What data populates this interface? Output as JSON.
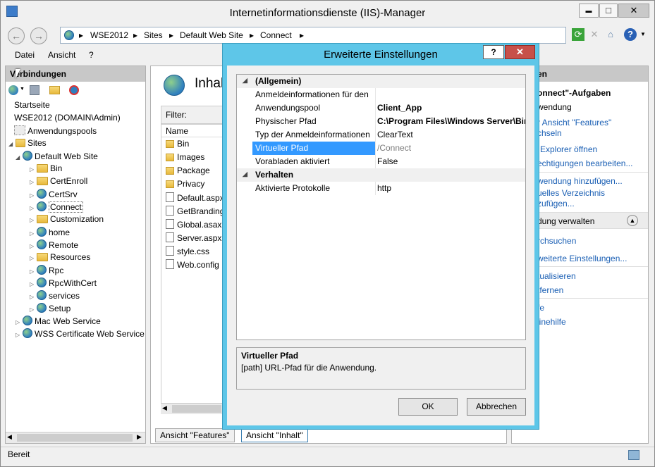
{
  "window": {
    "title": "Internetinformationsdienste (IIS)-Manager",
    "minimize": "▬",
    "maximize": "□",
    "close": "✕"
  },
  "address": {
    "crumbs": [
      "WSE2012",
      "Sites",
      "Default Web Site",
      "Connect"
    ],
    "separator": "▸"
  },
  "menu": [
    "Datei",
    "Ansicht",
    "?"
  ],
  "connections": {
    "header": "Verbindungen",
    "tree": [
      {
        "label": "Startseite",
        "level": 0,
        "icon": "home-icon"
      },
      {
        "label": "WSE2012 (DOMAIN\\Admin)",
        "level": 0,
        "icon": "server-icon"
      },
      {
        "label": "Anwendungspools",
        "level": 1,
        "icon": "pool-icon"
      },
      {
        "label": "Sites",
        "level": 1,
        "icon": "folder-icon"
      },
      {
        "label": "Default Web Site",
        "level": 2,
        "icon": "globe-icon"
      },
      {
        "label": "Bin",
        "level": 3,
        "icon": "folder-icon"
      },
      {
        "label": "CertEnroll",
        "level": 3,
        "icon": "folder-icon"
      },
      {
        "label": "CertSrv",
        "level": 3,
        "icon": "globe-icon"
      },
      {
        "label": "Connect",
        "level": 3,
        "icon": "globe-icon"
      },
      {
        "label": "Customization",
        "level": 3,
        "icon": "folder-icon"
      },
      {
        "label": "home",
        "level": 3,
        "icon": "globe-icon"
      },
      {
        "label": "Remote",
        "level": 3,
        "icon": "globe-icon"
      },
      {
        "label": "Resources",
        "level": 3,
        "icon": "folder-icon"
      },
      {
        "label": "Rpc",
        "level": 3,
        "icon": "globe-icon"
      },
      {
        "label": "RpcWithCert",
        "level": 3,
        "icon": "globe-icon"
      },
      {
        "label": "services",
        "level": 3,
        "icon": "globe-icon"
      },
      {
        "label": "Setup",
        "level": 3,
        "icon": "globe-icon"
      },
      {
        "label": "Mac Web Service",
        "level": 2,
        "icon": "globe-icon"
      },
      {
        "label": "WSS Certificate Web Service",
        "level": 2,
        "icon": "globe-icon"
      }
    ]
  },
  "content": {
    "title": "Inhal",
    "filter_label": "Filter:",
    "column_name": "Name",
    "files": [
      {
        "name": "Bin",
        "type": "folder"
      },
      {
        "name": "Images",
        "type": "folder"
      },
      {
        "name": "Package",
        "type": "folder"
      },
      {
        "name": "Privacy",
        "type": "folder"
      },
      {
        "name": "Default.aspx",
        "type": "file"
      },
      {
        "name": "GetBranding",
        "type": "file"
      },
      {
        "name": "Global.asax",
        "type": "file"
      },
      {
        "name": "Server.aspx",
        "type": "file"
      },
      {
        "name": "style.css",
        "type": "file"
      },
      {
        "name": "Web.config",
        "type": "file"
      }
    ],
    "tabs": [
      "Ansicht \"Features\"",
      "Ansicht \"Inhalt\""
    ]
  },
  "actions": {
    "header": "en",
    "items": [
      {
        "label": "onnect\"-Aufgaben",
        "kind": "heading"
      },
      {
        "label": "wendung",
        "kind": "plain"
      },
      {
        "label": "r Ansicht \"Features\"",
        "kind": "link"
      },
      {
        "label": "chseln",
        "kind": "link"
      },
      {
        "label": "Explorer öffnen",
        "kind": "link"
      },
      {
        "label": "echtigungen bearbeiten...",
        "kind": "link"
      },
      {
        "label": "wendung hinzufügen...",
        "kind": "link"
      },
      {
        "label": "uelles Verzeichnis",
        "kind": "link"
      },
      {
        "label": "zufügen...",
        "kind": "link"
      },
      {
        "label": "dung verwalten",
        "kind": "section"
      },
      {
        "label": "rchsuchen",
        "kind": "link"
      },
      {
        "label": "weiterte Einstellungen...",
        "kind": "link"
      },
      {
        "label": "tualisieren",
        "kind": "link"
      },
      {
        "label": "tfernen",
        "kind": "link"
      },
      {
        "label": "fe",
        "kind": "link"
      },
      {
        "label": "linehilfe",
        "kind": "link"
      }
    ]
  },
  "status": {
    "text": "Bereit"
  },
  "dialog": {
    "title": "Erweiterte Einstellungen",
    "help": "?",
    "close": "✕",
    "categories": [
      {
        "label": "(Allgemein)",
        "rows": [
          {
            "name": "Anmeldeinformationen für den",
            "value": ""
          },
          {
            "name": "Anwendungspool",
            "value": "Client_App",
            "bold": true
          },
          {
            "name": "Physischer Pfad",
            "value": "C:\\Program Files\\Windows Server\\Bin",
            "bold": true
          },
          {
            "name": "Typ der Anmeldeinformationen",
            "value": "ClearText"
          },
          {
            "name": "Virtueller Pfad",
            "value": "/Connect",
            "selected": true
          },
          {
            "name": "Vorabladen aktiviert",
            "value": "False"
          }
        ]
      },
      {
        "label": "Verhalten",
        "rows": [
          {
            "name": "Aktivierte Protokolle",
            "value": "http"
          }
        ]
      }
    ],
    "description": {
      "title": "Virtueller Pfad",
      "text": "[path] URL-Pfad für die Anwendung."
    },
    "ok": "OK",
    "cancel": "Abbrechen"
  }
}
